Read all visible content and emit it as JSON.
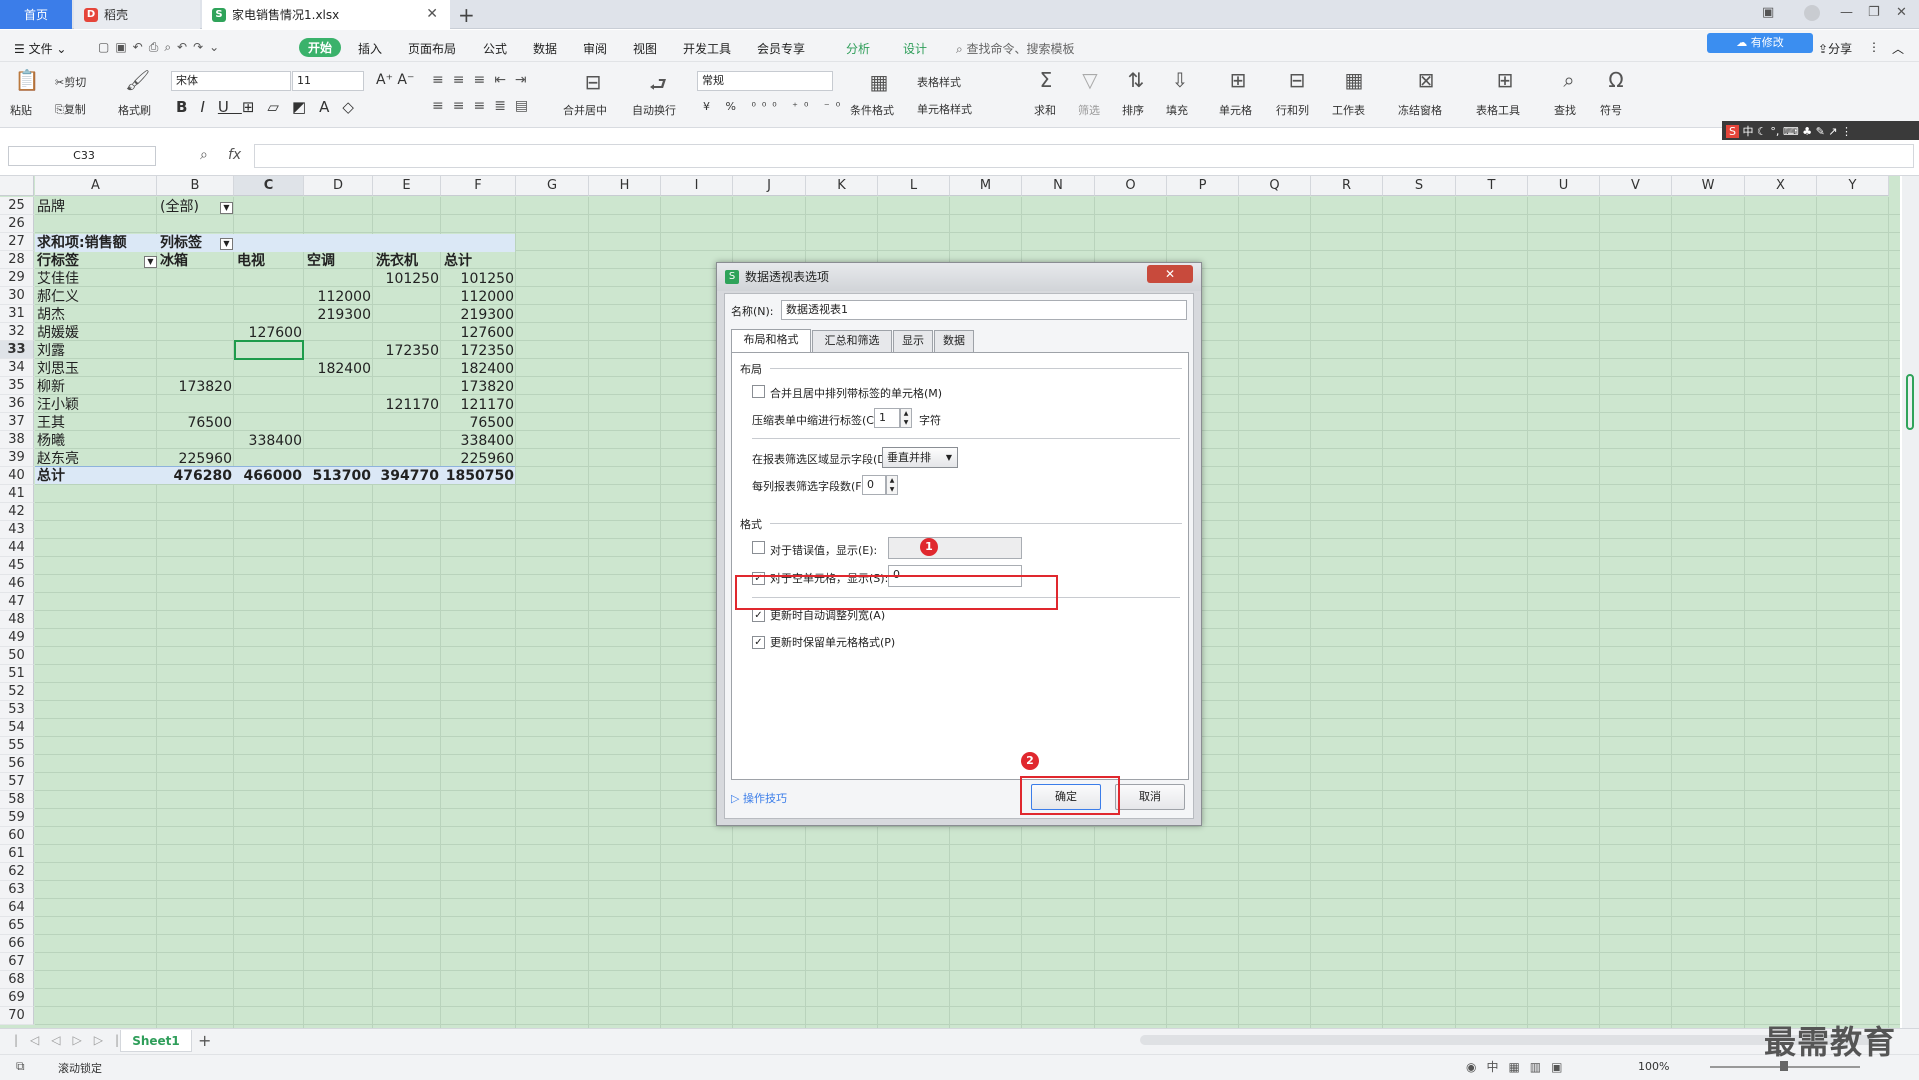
{
  "tabs": {
    "home": "首页",
    "daoke": "稻壳",
    "file": "家电销售情况1.xlsx"
  },
  "menu": {
    "file": "文件",
    "items": [
      "开始",
      "插入",
      "页面布局",
      "公式",
      "数据",
      "审阅",
      "视图",
      "开发工具",
      "会员专享",
      "分析",
      "设计"
    ],
    "search": "查找命令、搜索模板",
    "sync": "有修改",
    "share": "分享"
  },
  "ribbon": {
    "paste": "粘贴",
    "cut": "剪切",
    "copy": "复制",
    "format_painter": "格式刷",
    "font_name": "宋体",
    "font_size": "11",
    "merge": "合并居中",
    "wrap": "自动换行",
    "number_format": "常规",
    "cond_format": "条件格式",
    "table_style": "表格样式",
    "cell_style": "单元格样式",
    "sum": "求和",
    "filter": "筛选",
    "sort": "排序",
    "fill": "填充",
    "cell": "单元格",
    "rowcol": "行和列",
    "worksheet": "工作表",
    "freeze": "冻结窗格",
    "table_tools": "表格工具",
    "find": "查找",
    "symbol": "符号"
  },
  "ime": "中",
  "formula": {
    "namebox": "C33",
    "fx": "fx",
    "value": ""
  },
  "columns": [
    "A",
    "B",
    "C",
    "D",
    "E",
    "F",
    "G",
    "H",
    "I",
    "J",
    "K",
    "L",
    "M",
    "N",
    "O",
    "P",
    "Q",
    "R",
    "S",
    "T",
    "U",
    "V",
    "W",
    "X",
    "Y"
  ],
  "row_numbers": [
    "25",
    "26",
    "27",
    "28",
    "29",
    "30",
    "31",
    "32",
    "33",
    "34",
    "35",
    "36",
    "37",
    "38",
    "39",
    "40",
    "41",
    "42",
    "43",
    "44",
    "45",
    "46",
    "47",
    "48",
    "49",
    "50",
    "51",
    "52",
    "53",
    "54",
    "55",
    "56",
    "57",
    "58",
    "59",
    "60",
    "61",
    "62",
    "63",
    "64",
    "65",
    "66",
    "67",
    "68",
    "69",
    "70"
  ],
  "pivot": {
    "filter_label": "品牌",
    "filter_value": "(全部)",
    "sum_label": "求和项:销售额",
    "col_label": "列标签",
    "row_label": "行标签",
    "headers": [
      "冰箱",
      "电视",
      "空调",
      "洗衣机",
      "总计"
    ],
    "rows": [
      {
        "name": "艾佳佳",
        "vals": [
          "",
          "",
          "",
          "101250",
          "101250"
        ]
      },
      {
        "name": "郝仁义",
        "vals": [
          "",
          "",
          "112000",
          "",
          "112000"
        ]
      },
      {
        "name": "胡杰",
        "vals": [
          "",
          "",
          "219300",
          "",
          "219300"
        ]
      },
      {
        "name": "胡媛媛",
        "vals": [
          "",
          "127600",
          "",
          "",
          "127600"
        ]
      },
      {
        "name": "刘露",
        "vals": [
          "",
          "",
          "",
          "172350",
          "172350"
        ]
      },
      {
        "name": "刘思玉",
        "vals": [
          "",
          "",
          "182400",
          "",
          "182400"
        ]
      },
      {
        "name": "柳新",
        "vals": [
          "173820",
          "",
          "",
          "",
          "173820"
        ]
      },
      {
        "name": "汪小颖",
        "vals": [
          "",
          "",
          "",
          "121170",
          "121170"
        ]
      },
      {
        "name": "王其",
        "vals": [
          "76500",
          "",
          "",
          "",
          "76500"
        ]
      },
      {
        "name": "杨曦",
        "vals": [
          "",
          "338400",
          "",
          "",
          "338400"
        ]
      },
      {
        "name": "赵东亮",
        "vals": [
          "225960",
          "",
          "",
          "",
          "225960"
        ]
      }
    ],
    "total_label": "总计",
    "totals": [
      "476280",
      "466000",
      "513700",
      "394770",
      "1850750"
    ]
  },
  "dialog": {
    "title": "数据透视表选项",
    "name_label": "名称(N):",
    "name_value": "数据透视表1",
    "tabs": [
      "布局和格式",
      "汇总和筛选",
      "显示",
      "数据"
    ],
    "layout_section": "布局",
    "merge_center": "合并且居中排列带标签的单元格(M)",
    "indent_label": "压缩表单中缩进行标签(C):",
    "indent_value": "1",
    "indent_unit": "字符",
    "filter_area_label": "在报表筛选区域显示字段(D):",
    "filter_area_value": "垂直并排",
    "filter_fields_label": "每列报表筛选字段数(F):",
    "filter_fields_value": "0",
    "format_section": "格式",
    "error_label": "对于错误值，显示(E):",
    "empty_label": "对于空单元格，显示(S):",
    "empty_value": "0",
    "autofit_label": "更新时自动调整列宽(A)",
    "preserve_label": "更新时保留单元格格式(P)",
    "tips": "操作技巧",
    "ok": "确定",
    "cancel": "取消",
    "marker1": "1",
    "marker2": "2"
  },
  "sheets": [
    "Sheet1"
  ],
  "status": {
    "scroll_lock": "滚动锁定",
    "zoom": "100%"
  },
  "watermark": "最需教育",
  "colors": {
    "grid_bg": "#cde6cf",
    "accent": "#3b7de9",
    "annotation": "#e0282e"
  }
}
